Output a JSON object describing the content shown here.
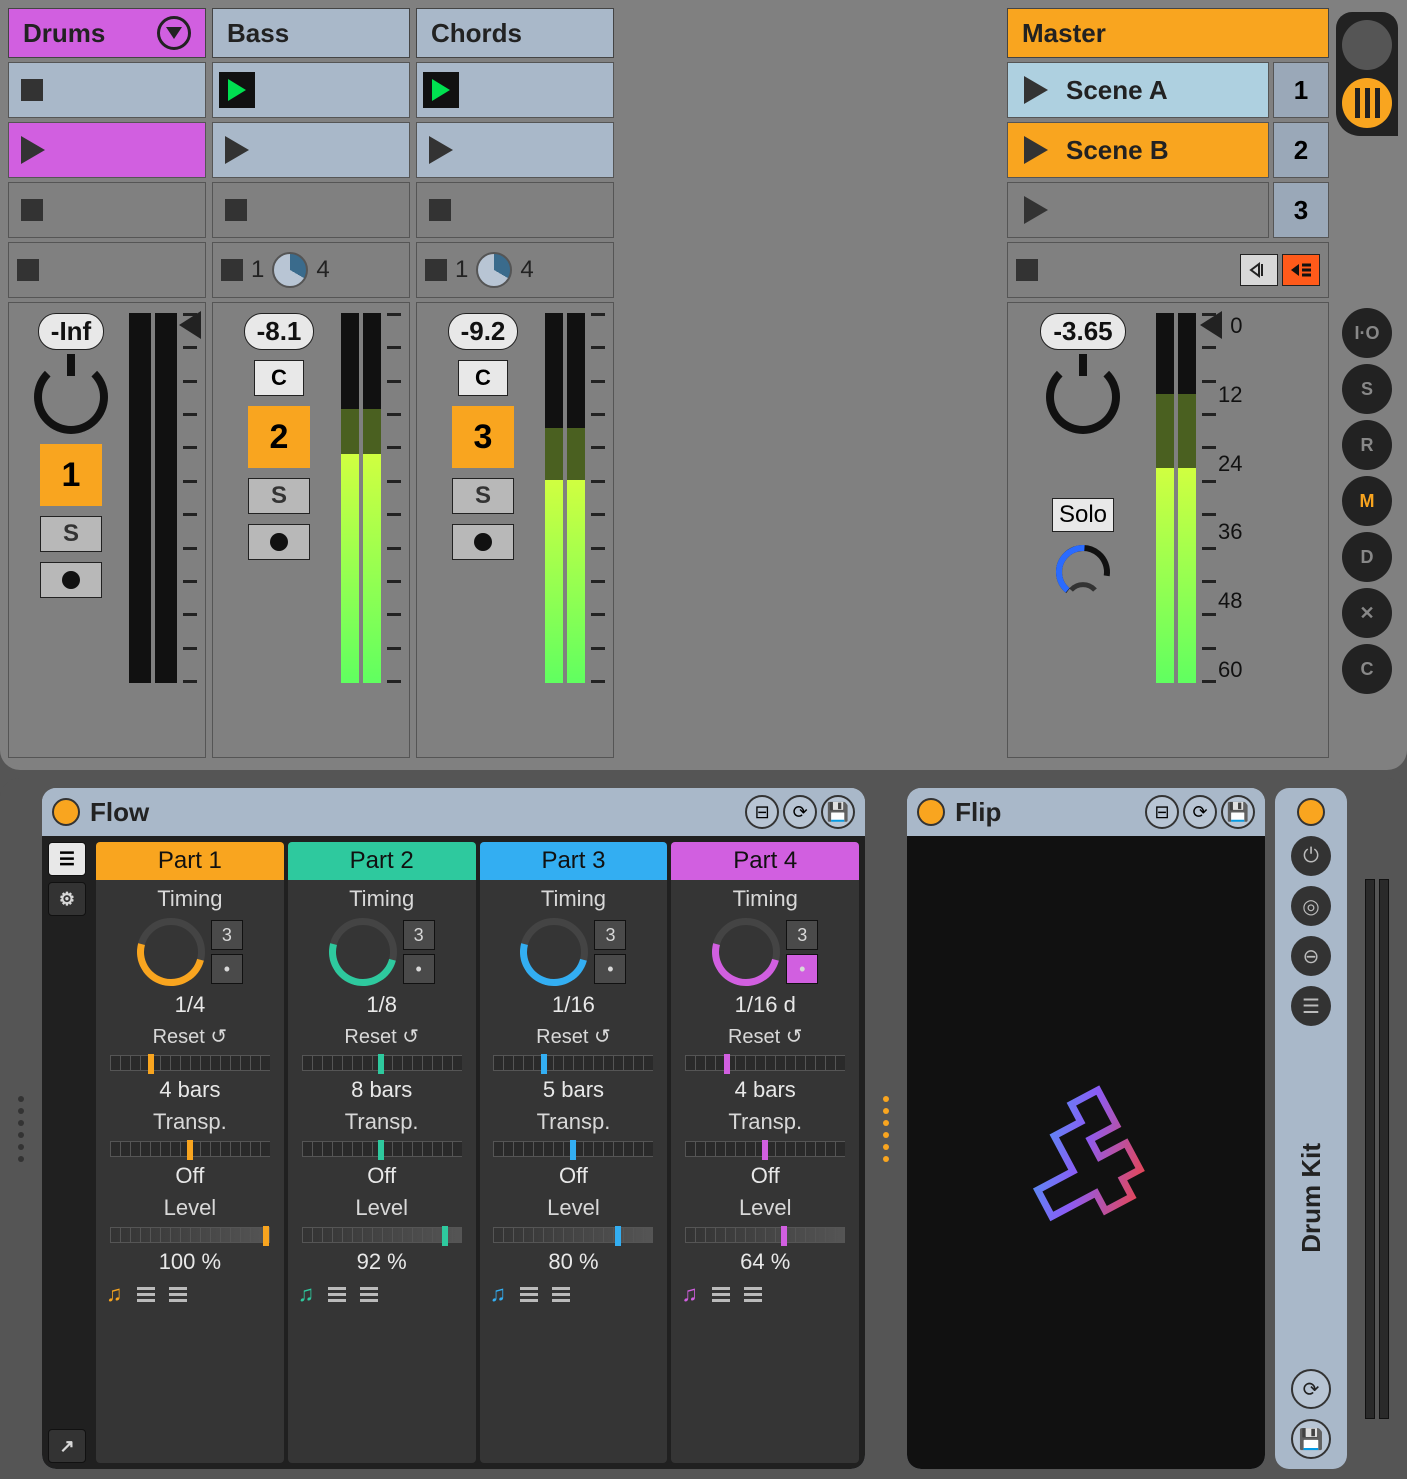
{
  "tracks": {
    "drums": {
      "name": "Drums",
      "db": "-Inf",
      "num": "1"
    },
    "bass": {
      "name": "Bass",
      "db": "-8.1",
      "num": "2",
      "launch_a": "1",
      "launch_b": "4"
    },
    "chords": {
      "name": "Chords",
      "db": "-9.2",
      "num": "3",
      "launch_a": "1",
      "launch_b": "4"
    }
  },
  "master": {
    "name": "Master",
    "db": "-3.65",
    "scenes": [
      {
        "label": "Scene A",
        "n": "1"
      },
      {
        "label": "Scene B",
        "n": "2"
      },
      {
        "label": "",
        "n": "3"
      }
    ],
    "solo": "Solo",
    "scale": [
      "0",
      "12",
      "24",
      "36",
      "48",
      "60"
    ]
  },
  "common": {
    "c": "C",
    "s": "S"
  },
  "side": {
    "io": "I·O",
    "s": "S",
    "r": "R",
    "m": "M",
    "d": "D",
    "x": "✕",
    "c": "C"
  },
  "flow": {
    "title": "Flow",
    "parts": [
      {
        "hdr": "Part 1",
        "timing": "Timing",
        "sub": "3",
        "rate": "1/4",
        "reset": "Reset ↺",
        "bars": "4 bars",
        "transp": "Transp.",
        "off": "Off",
        "level": "Level",
        "pct": "100 %"
      },
      {
        "hdr": "Part 2",
        "timing": "Timing",
        "sub": "3",
        "rate": "1/8",
        "reset": "Reset ↺",
        "bars": "8 bars",
        "transp": "Transp.",
        "off": "Off",
        "level": "Level",
        "pct": "92 %"
      },
      {
        "hdr": "Part 3",
        "timing": "Timing",
        "sub": "3",
        "rate": "1/16",
        "reset": "Reset ↺",
        "bars": "5 bars",
        "transp": "Transp.",
        "off": "Off",
        "level": "Level",
        "pct": "80 %"
      },
      {
        "hdr": "Part 4",
        "timing": "Timing",
        "sub": "3",
        "rate": "1/16 d",
        "reset": "Reset ↺",
        "bars": "4 bars",
        "transp": "Transp.",
        "off": "Off",
        "level": "Level",
        "pct": "64 %"
      }
    ]
  },
  "flip": {
    "title": "Flip"
  },
  "drumkit": {
    "title": "Drum Kit"
  }
}
